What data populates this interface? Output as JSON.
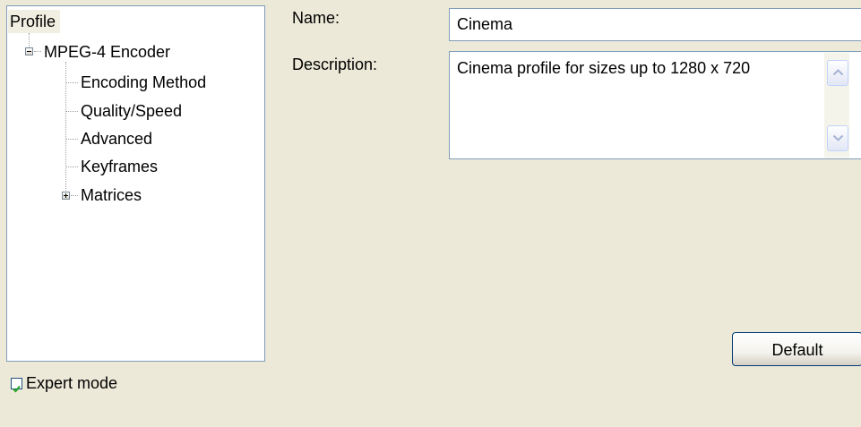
{
  "tree": {
    "root_label": "Profile",
    "encoder": {
      "label": "MPEG-4 Encoder",
      "expanded": true,
      "children": [
        {
          "label": "Encoding Method"
        },
        {
          "label": "Quality/Speed"
        },
        {
          "label": "Advanced"
        },
        {
          "label": "Keyframes"
        },
        {
          "label": "Matrices",
          "expanded": false
        }
      ]
    }
  },
  "expert_mode": {
    "label": "Expert mode",
    "checked": true
  },
  "form": {
    "name_label": "Name:",
    "name_value": "Cinema",
    "description_label": "Description:",
    "description_value": "Cinema profile for sizes up to 1280 x 720"
  },
  "buttons": {
    "default_label": "Default"
  },
  "colors": {
    "window_background": "#ECE9D8",
    "field_border": "#7F9DB9",
    "checkmark": "#21A121",
    "selected_node_background": "#F1EFE2"
  }
}
